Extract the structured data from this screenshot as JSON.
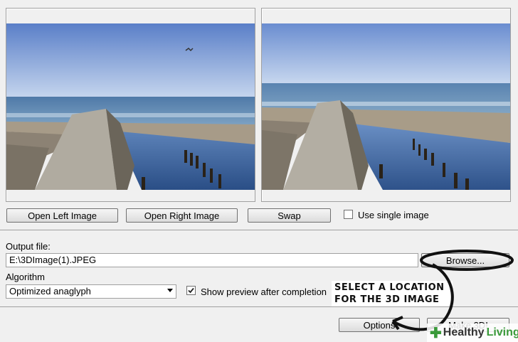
{
  "buttons": {
    "open_left": "Open Left Image",
    "open_right": "Open Right Image",
    "swap": "Swap",
    "browse": "Browse...",
    "options": "Options",
    "make3d": "Make 3D!"
  },
  "single_image": {
    "label": "Use single image",
    "checked": false
  },
  "output": {
    "label": "Output file:",
    "value": "E:\\3DImage(1).JPEG"
  },
  "algorithm": {
    "label": "Algorithm",
    "selected": "Optimized anaglyph"
  },
  "preview": {
    "label": "Show preview after completion",
    "checked": true
  },
  "annotation": {
    "line1": "SELECT A LOCATION",
    "line2": "FOR THE 3D IMAGE"
  },
  "watermark": {
    "brand_word1": "Healthy",
    "brand_word2": "Living"
  },
  "colors": {
    "annotation_highlight": "#1a1a1a",
    "brand_green": "#3a9a3a"
  }
}
